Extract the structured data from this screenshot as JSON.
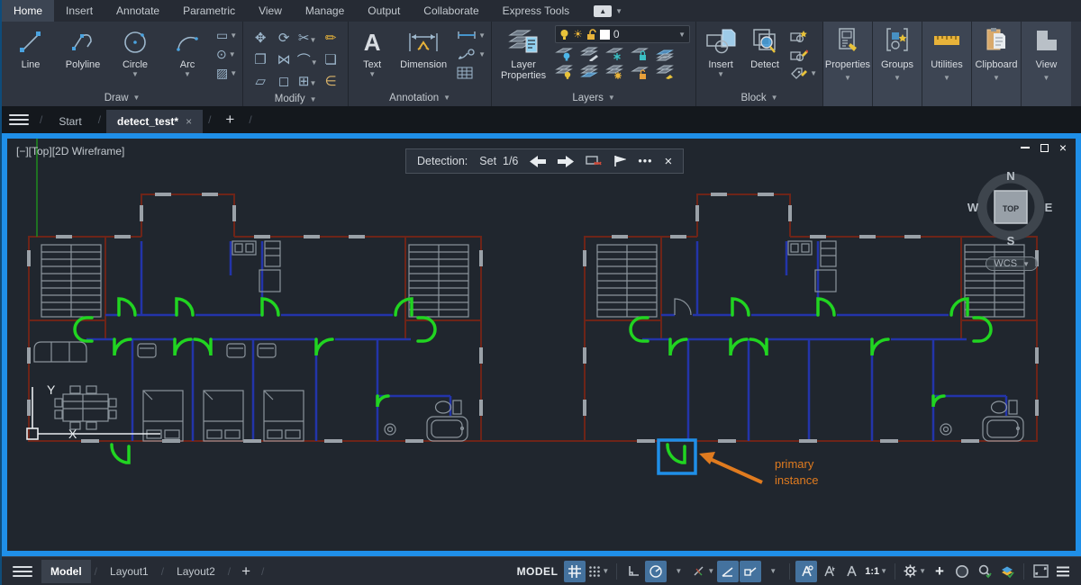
{
  "colors": {
    "accent": "#1f8fe8",
    "canvas": "#20262e",
    "wall": "#6e2418",
    "blue": "#2334aa",
    "green": "#21d421",
    "gray": "#8b949c",
    "orange": "#e07b1f",
    "togg": "#44729e"
  },
  "menubar": {
    "tabs": [
      "Home",
      "Insert",
      "Annotate",
      "Parametric",
      "View",
      "Manage",
      "Output",
      "Collaborate",
      "Express Tools"
    ],
    "active_tab": "Home"
  },
  "ribbon": {
    "draw": {
      "label": "Draw",
      "line": "Line",
      "polyline": "Polyline",
      "circle": "Circle",
      "arc": "Arc"
    },
    "modify": {
      "label": "Modify"
    },
    "annotation": {
      "label": "Annotation",
      "text": "Text",
      "dimension": "Dimension"
    },
    "layers": {
      "label": "Layers",
      "lp1": "Layer",
      "lp2": "Properties",
      "current_layer": "0"
    },
    "block": {
      "label": "Block",
      "insert": "Insert",
      "detect": "Detect"
    },
    "panels": {
      "properties": "Properties",
      "groups": "Groups",
      "utilities": "Utilities",
      "clipboard": "Clipboard",
      "view": "View"
    }
  },
  "file_tabs": {
    "start": "Start",
    "drawing": "detect_test*",
    "close": "×",
    "new": "+"
  },
  "viewport": {
    "controls_label": "[−][Top][2D Wireframe]",
    "viewcube": {
      "north": "N",
      "south": "S",
      "east": "E",
      "west": "W",
      "top_face": "TOP"
    },
    "wcs_label": "WCS",
    "ucs_x": "X",
    "ucs_y": "Y"
  },
  "detection_toolbar": {
    "title": "Detection:",
    "set_label": "Set",
    "set_count": "1/6",
    "more": "•••",
    "close": "×"
  },
  "callout": {
    "line1": "primary",
    "line2": "instance"
  },
  "status_bar": {
    "model_tab": "Model",
    "layout1_tab": "Layout1",
    "layout2_tab": "Layout2",
    "model_badge": "MODEL",
    "scale_label": "1:1"
  }
}
